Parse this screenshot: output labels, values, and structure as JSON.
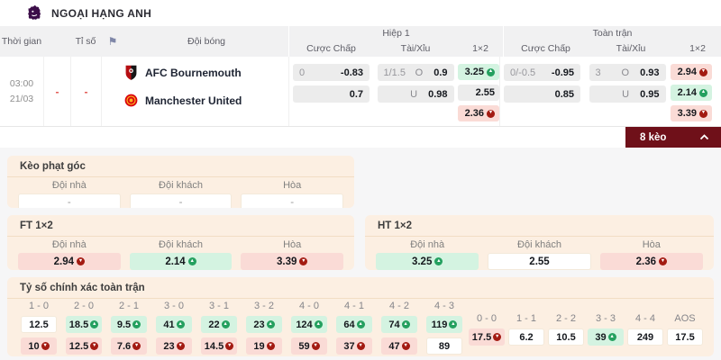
{
  "colors": {
    "accent_maroon": "#6f1019",
    "trend_up_circle": "#24a05f",
    "trend_down_circle": "#a31b12",
    "up_box_bg": "#d4f3e1",
    "down_box_bg": "#fadbd6",
    "section_bg": "#fcefe2"
  },
  "icons": {
    "corner_flag_glyph": "⚑",
    "trend_up_glyph": "▲",
    "trend_down_glyph": "▼"
  },
  "header": {
    "league_title": "NGOẠI HẠNG ANH"
  },
  "table": {
    "columns": {
      "time": "Thời gian",
      "score": "Tỉ số",
      "teams": "Đội bóng",
      "group_half1": "Hiệp 1",
      "group_full": "Toàn trận",
      "handicap": "Cược Chấp",
      "over_under": "Tài/Xỉu",
      "one_x_two": "1×2"
    },
    "match": {
      "time": "03:00",
      "date": "21/03",
      "status": "-",
      "score": "-",
      "home_team": "AFC Bournemouth",
      "away_team": "Manchester United",
      "half1": {
        "handicap": [
          {
            "line": "0",
            "odds": "-0.83"
          },
          {
            "line": "",
            "odds": "0.7"
          }
        ],
        "over_under": [
          {
            "line": "1/1.5",
            "side": "O",
            "odds": "0.9"
          },
          {
            "line": "",
            "side": "U",
            "odds": "0.98"
          }
        ],
        "one_x_two": [
          {
            "odds": "3.25",
            "trend": "up"
          },
          {
            "odds": "2.55",
            "trend": "none"
          },
          {
            "odds": "2.36",
            "trend": "down"
          }
        ]
      },
      "full": {
        "handicap": [
          {
            "line": "0/-0.5",
            "odds": "-0.95"
          },
          {
            "line": "",
            "odds": "0.85"
          }
        ],
        "over_under": [
          {
            "line": "3",
            "side": "O",
            "odds": "0.93"
          },
          {
            "line": "",
            "side": "U",
            "odds": "0.95"
          }
        ],
        "one_x_two": [
          {
            "odds": "2.94",
            "trend": "down"
          },
          {
            "odds": "2.14",
            "trend": "up"
          },
          {
            "odds": "3.39",
            "trend": "down"
          }
        ]
      }
    }
  },
  "keo_bar": {
    "label": "8 kèo"
  },
  "sections": {
    "corner": {
      "title": "Kèo phạt góc",
      "headers": [
        "Đội nhà",
        "Đội khách",
        "Hòa"
      ],
      "values": [
        {
          "odds": "-",
          "trend": "none"
        },
        {
          "odds": "-",
          "trend": "none"
        },
        {
          "odds": "-",
          "trend": "none"
        }
      ]
    },
    "ft_1x2": {
      "title": "FT 1×2",
      "headers": [
        "Đội nhà",
        "Đội khách",
        "Hòa"
      ],
      "values": [
        {
          "odds": "2.94",
          "trend": "down"
        },
        {
          "odds": "2.14",
          "trend": "up"
        },
        {
          "odds": "3.39",
          "trend": "down"
        }
      ]
    },
    "ht_1x2": {
      "title": "HT 1×2",
      "headers": [
        "Đội nhà",
        "Đội khách",
        "Hòa"
      ],
      "values": [
        {
          "odds": "3.25",
          "trend": "up"
        },
        {
          "odds": "2.55",
          "trend": "none"
        },
        {
          "odds": "2.36",
          "trend": "down"
        }
      ]
    },
    "correct_score": {
      "title": "Tỷ số chính xác toàn trận",
      "win_scores": [
        {
          "score": "1 - 0",
          "top": {
            "odds": "12.5",
            "trend": "none"
          },
          "bottom": {
            "odds": "10",
            "trend": "down"
          }
        },
        {
          "score": "2 - 0",
          "top": {
            "odds": "18.5",
            "trend": "up"
          },
          "bottom": {
            "odds": "12.5",
            "trend": "down"
          }
        },
        {
          "score": "2 - 1",
          "top": {
            "odds": "9.5",
            "trend": "up"
          },
          "bottom": {
            "odds": "7.6",
            "trend": "down"
          }
        },
        {
          "score": "3 - 0",
          "top": {
            "odds": "41",
            "trend": "up"
          },
          "bottom": {
            "odds": "23",
            "trend": "down"
          }
        },
        {
          "score": "3 - 1",
          "top": {
            "odds": "22",
            "trend": "up"
          },
          "bottom": {
            "odds": "14.5",
            "trend": "down"
          }
        },
        {
          "score": "3 - 2",
          "top": {
            "odds": "23",
            "trend": "up"
          },
          "bottom": {
            "odds": "19",
            "trend": "down"
          }
        },
        {
          "score": "4 - 0",
          "top": {
            "odds": "124",
            "trend": "up"
          },
          "bottom": {
            "odds": "59",
            "trend": "down"
          }
        },
        {
          "score": "4 - 1",
          "top": {
            "odds": "64",
            "trend": "up"
          },
          "bottom": {
            "odds": "37",
            "trend": "down"
          }
        },
        {
          "score": "4 - 2",
          "top": {
            "odds": "74",
            "trend": "up"
          },
          "bottom": {
            "odds": "47",
            "trend": "down"
          }
        },
        {
          "score": "4 - 3",
          "top": {
            "odds": "119",
            "trend": "up"
          },
          "bottom": {
            "odds": "89",
            "trend": "none"
          }
        }
      ],
      "draw_scores": [
        {
          "score": "0 - 0",
          "odds": "17.5",
          "trend": "down"
        },
        {
          "score": "1 - 1",
          "odds": "6.2",
          "trend": "none"
        },
        {
          "score": "2 - 2",
          "odds": "10.5",
          "trend": "none"
        },
        {
          "score": "3 - 3",
          "odds": "39",
          "trend": "up"
        },
        {
          "score": "4 - 4",
          "odds": "249",
          "trend": "none"
        },
        {
          "score": "AOS",
          "odds": "17.5",
          "trend": "none"
        }
      ]
    }
  }
}
